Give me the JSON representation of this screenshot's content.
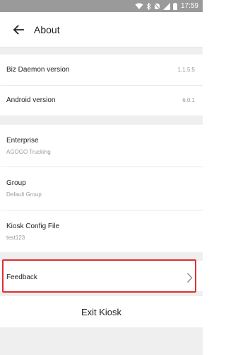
{
  "status_bar": {
    "time": "17:59",
    "icons": [
      "wifi-icon",
      "bluetooth-icon",
      "no-sim-icon",
      "signal-icon",
      "battery-icon"
    ]
  },
  "app_bar": {
    "title": "About",
    "back_icon": "back-arrow-icon"
  },
  "info": {
    "biz_daemon": {
      "label": "Biz Daemon version",
      "value": "1.1.5.5"
    },
    "android": {
      "label": "Android version",
      "value": "6.0.1"
    }
  },
  "config": {
    "enterprise": {
      "label": "Enterprise",
      "value": "AGOGO Trucking"
    },
    "group": {
      "label": "Group",
      "value": "Default Group"
    },
    "kiosk_config": {
      "label": "Kiosk Config File",
      "value": "test123"
    }
  },
  "feedback": {
    "label": "Feedback",
    "icon": "chevron-right-icon"
  },
  "exit": {
    "label": "Exit Kiosk"
  },
  "colors": {
    "highlight": "#e03030",
    "status_bar": "#9a9a9a",
    "secondary_text": "#9a9a9a"
  }
}
